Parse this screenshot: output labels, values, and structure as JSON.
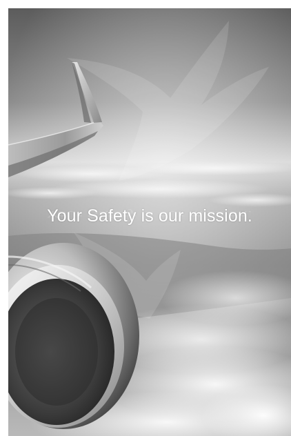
{
  "poster": {
    "slogan": "Your Safety is our mission."
  },
  "colors": {
    "sky_top": "#5a5a5a",
    "sky_haze": "#d4d4d4",
    "ocean": "#8e8e8e",
    "clouds": "#ececec",
    "slogan_text": "#ffffff"
  },
  "icons": {
    "watermark": "bird-watermark-icon"
  }
}
